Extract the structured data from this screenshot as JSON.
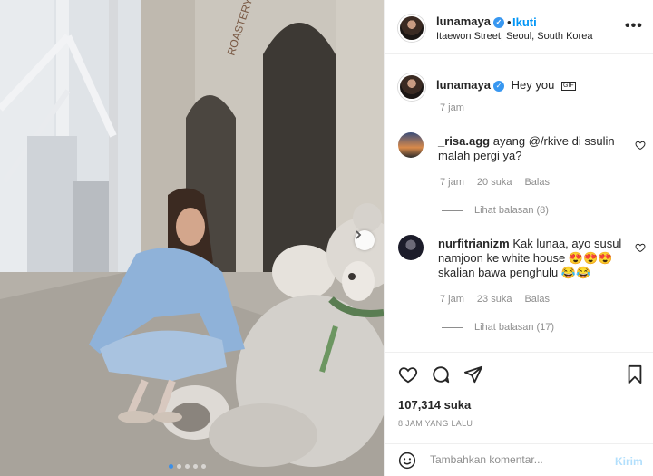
{
  "post": {
    "author": "lunamaya",
    "follow_label": "Ikuti",
    "location": "Itaewon Street, Seoul, South Korea",
    "more_label": "•••",
    "storefront_sign": "ROASTERY",
    "carousel": {
      "slide_count": 5,
      "active_index": 0
    }
  },
  "caption": {
    "username": "lunamaya",
    "text": "Hey you",
    "gif_badge": "GIF",
    "time": "7 jam"
  },
  "comments": [
    {
      "username": "_risa.agg",
      "text_line1": "ayang @/rkive di ssulin",
      "text_line2": "malah pergi ya?",
      "time": "7 jam",
      "likes": "20 suka",
      "reply_label": "Balas",
      "view_replies": "Lihat balasan (8)"
    },
    {
      "username": "nurfitrianizm",
      "text_line1": "Kak lunaa, ayo susul",
      "text_line2": "namjoon ke white house 😍😍😍",
      "text_line3": "skalian bawa penghulu 😂😂",
      "time": "7 jam",
      "likes": "23 suka",
      "reply_label": "Balas",
      "view_replies": "Lihat balasan (17)"
    }
  ],
  "footer": {
    "likes": "107,314 suka",
    "time_ago": "8 JAM YANG LALU",
    "comment_placeholder": "Tambahkan komentar...",
    "post_label": "Kirim"
  },
  "colors": {
    "accent": "#0095f6",
    "verified": "#3897f0",
    "muted": "#8e8e8e",
    "post_disabled": "#b2dffc"
  }
}
